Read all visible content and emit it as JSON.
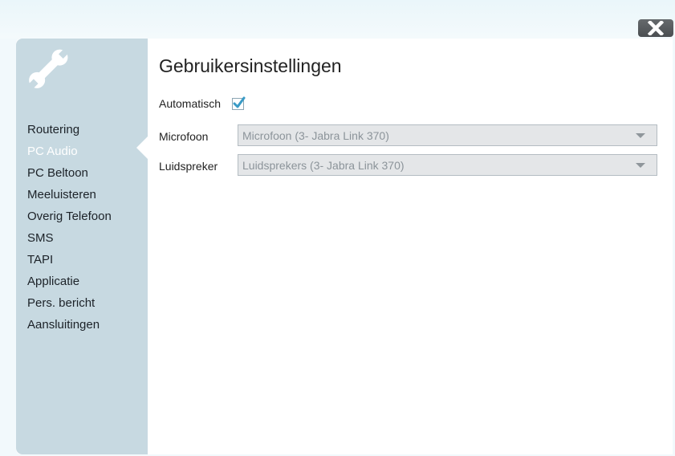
{
  "window": {
    "title": "Gebruikersinstellingen",
    "close_icon": "close-icon"
  },
  "sidebar": {
    "icon": "wrench-icon",
    "active_index": 1,
    "items": [
      {
        "label": "Routering"
      },
      {
        "label": "PC Audio"
      },
      {
        "label": "PC Beltoon"
      },
      {
        "label": "Meeluisteren"
      },
      {
        "label": "Overig Telefoon"
      },
      {
        "label": "SMS"
      },
      {
        "label": "TAPI"
      },
      {
        "label": "Applicatie"
      },
      {
        "label": "Pers. bericht"
      },
      {
        "label": "Aansluitingen"
      }
    ]
  },
  "form": {
    "automatic": {
      "label": "Automatisch",
      "checked": true
    },
    "microphone": {
      "label": "Microfoon",
      "value": "Microfoon (3- Jabra Link 370)"
    },
    "speaker": {
      "label": "Luidspreker",
      "value": "Luidsprekers (3- Jabra Link 370)"
    }
  },
  "colors": {
    "sidebar_bg": "#c7d9e1",
    "active_text": "#ffffff",
    "checkmark": "#3a9bc6",
    "select_bg": "#e4e6e8",
    "select_text": "#8c949a"
  }
}
